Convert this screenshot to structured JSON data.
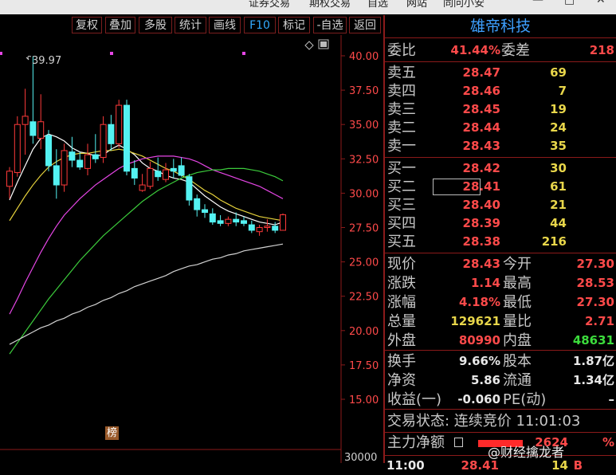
{
  "top_menu": [
    "证券交易",
    "期权交易",
    "自选",
    "网站",
    "同问小安"
  ],
  "toolbar": [
    {
      "label": "复权"
    },
    {
      "label": "叠加"
    },
    {
      "label": "多股"
    },
    {
      "label": "统计"
    },
    {
      "label": "画线"
    },
    {
      "label": "F10",
      "active": true
    },
    {
      "label": "标记"
    },
    {
      "label": "-自选"
    },
    {
      "label": "返回"
    }
  ],
  "chart_data": {
    "type": "candlestick",
    "price_axis": {
      "ticks": [
        "40.00",
        "37.50",
        "35.00",
        "32.50",
        "30.00",
        "27.50",
        "25.00",
        "22.50",
        "20.00",
        "17.50",
        "15.00"
      ],
      "ylim": [
        15.0,
        40.0
      ]
    },
    "volume_axis_label": "30000",
    "max_marker": "39.97",
    "badge": "榜",
    "candles": [
      {
        "o": 30.5,
        "h": 31.9,
        "l": 29.6,
        "c": 31.6
      },
      {
        "o": 31.5,
        "h": 35.6,
        "l": 31.2,
        "c": 35.0
      },
      {
        "o": 35.0,
        "h": 37.6,
        "l": 32.8,
        "c": 35.6
      },
      {
        "o": 35.2,
        "h": 39.97,
        "l": 33.6,
        "c": 34.2
      },
      {
        "o": 34.0,
        "h": 37.2,
        "l": 33.2,
        "c": 35.2
      },
      {
        "o": 34.2,
        "h": 34.6,
        "l": 31.6,
        "c": 32.0
      },
      {
        "o": 32.0,
        "h": 33.2,
        "l": 29.6,
        "c": 30.6
      },
      {
        "o": 30.6,
        "h": 33.6,
        "l": 30.1,
        "c": 33.1
      },
      {
        "o": 33.0,
        "h": 34.1,
        "l": 31.9,
        "c": 32.4
      },
      {
        "o": 32.4,
        "h": 33.0,
        "l": 31.7,
        "c": 31.9
      },
      {
        "o": 31.8,
        "h": 33.6,
        "l": 31.3,
        "c": 32.8
      },
      {
        "o": 32.8,
        "h": 34.3,
        "l": 32.2,
        "c": 32.5
      },
      {
        "o": 32.6,
        "h": 35.6,
        "l": 32.2,
        "c": 35.0
      },
      {
        "o": 35.0,
        "h": 35.7,
        "l": 33.1,
        "c": 33.6
      },
      {
        "o": 33.6,
        "h": 36.8,
        "l": 33.3,
        "c": 36.4
      },
      {
        "o": 36.4,
        "h": 36.8,
        "l": 31.3,
        "c": 31.6
      },
      {
        "o": 31.8,
        "h": 32.4,
        "l": 30.6,
        "c": 31.1
      },
      {
        "o": 30.2,
        "h": 31.4,
        "l": 30.1,
        "c": 30.6
      },
      {
        "o": 30.5,
        "h": 32.3,
        "l": 30.3,
        "c": 31.8
      },
      {
        "o": 31.6,
        "h": 32.6,
        "l": 30.9,
        "c": 31.2
      },
      {
        "o": 31.0,
        "h": 32.2,
        "l": 30.8,
        "c": 31.7
      },
      {
        "o": 31.8,
        "h": 32.5,
        "l": 31.1,
        "c": 31.6
      },
      {
        "o": 32.0,
        "h": 32.6,
        "l": 31.2,
        "c": 31.3
      },
      {
        "o": 31.2,
        "h": 31.4,
        "l": 29.1,
        "c": 29.5
      },
      {
        "o": 29.6,
        "h": 29.9,
        "l": 28.3,
        "c": 28.8
      },
      {
        "o": 28.8,
        "h": 29.2,
        "l": 28.2,
        "c": 28.6
      },
      {
        "o": 28.5,
        "h": 28.9,
        "l": 27.7,
        "c": 27.9
      },
      {
        "o": 28.0,
        "h": 28.4,
        "l": 27.6,
        "c": 27.8
      },
      {
        "o": 27.8,
        "h": 28.3,
        "l": 27.6,
        "c": 28.1
      },
      {
        "o": 28.1,
        "h": 28.6,
        "l": 27.6,
        "c": 27.9
      },
      {
        "o": 28.0,
        "h": 28.3,
        "l": 27.6,
        "c": 27.8
      },
      {
        "o": 27.7,
        "h": 28.0,
        "l": 27.1,
        "c": 27.3
      },
      {
        "o": 27.2,
        "h": 27.7,
        "l": 26.9,
        "c": 27.5
      },
      {
        "o": 27.5,
        "h": 28.1,
        "l": 27.2,
        "c": 27.6
      },
      {
        "o": 27.6,
        "h": 27.9,
        "l": 27.1,
        "c": 27.3
      },
      {
        "o": 27.3,
        "h": 28.53,
        "l": 27.3,
        "c": 28.43
      }
    ],
    "ma_lines": [
      {
        "color": "#ffffff",
        "values": [
          29.5,
          30.8,
          32.0,
          33.2,
          34.0,
          34.3,
          34.1,
          33.8,
          33.3,
          33.0,
          32.9,
          32.7,
          32.8,
          33.2,
          33.5,
          33.2,
          32.8,
          32.2,
          31.8,
          31.6,
          31.3,
          31.1,
          31.0,
          30.8,
          30.3,
          29.8,
          29.4,
          29.0,
          28.7,
          28.5,
          28.3,
          28.1,
          27.9,
          27.8,
          27.7,
          27.9
        ]
      },
      {
        "color": "#e6d23c",
        "values": [
          28.0,
          28.9,
          29.8,
          30.6,
          31.3,
          31.9,
          32.3,
          32.6,
          32.8,
          32.9,
          32.9,
          33.0,
          33.1,
          33.1,
          33.2,
          33.1,
          32.9,
          32.7,
          32.4,
          32.1,
          31.8,
          31.6,
          31.3,
          31.0,
          30.6,
          30.2,
          29.9,
          29.5,
          29.2,
          28.9,
          28.7,
          28.5,
          28.3,
          28.2,
          28.1,
          28.0
        ]
      },
      {
        "color": "#e646e6",
        "values": [
          21.2,
          22.3,
          23.5,
          24.6,
          25.7,
          26.7,
          27.6,
          28.4,
          29.0,
          29.6,
          30.1,
          30.6,
          31.0,
          31.4,
          31.8,
          32.1,
          32.3,
          32.5,
          32.6,
          32.7,
          32.7,
          32.7,
          32.6,
          32.5,
          32.3,
          32.0,
          31.7,
          31.5,
          31.3,
          31.1,
          30.9,
          30.7,
          30.5,
          30.2,
          29.9,
          29.6
        ]
      },
      {
        "color": "#3ccc3c",
        "values": [
          18.3,
          19.1,
          19.9,
          20.7,
          21.5,
          22.3,
          23.0,
          23.7,
          24.4,
          25.1,
          25.7,
          26.3,
          26.9,
          27.4,
          27.9,
          28.4,
          28.9,
          29.4,
          29.8,
          30.2,
          30.5,
          30.8,
          31.1,
          31.3,
          31.5,
          31.6,
          31.7,
          31.7,
          31.8,
          31.8,
          31.8,
          31.7,
          31.6,
          31.4,
          31.2,
          30.9
        ]
      },
      {
        "color": "#d2d2d2",
        "values": [
          19.0,
          19.3,
          19.6,
          19.9,
          20.2,
          20.4,
          20.7,
          20.9,
          21.2,
          21.4,
          21.7,
          21.9,
          22.2,
          22.4,
          22.7,
          22.9,
          23.2,
          23.4,
          23.6,
          23.8,
          24.0,
          24.3,
          24.5,
          24.7,
          24.8,
          25.0,
          25.2,
          25.3,
          25.5,
          25.6,
          25.8,
          25.9,
          26.0,
          26.1,
          26.2,
          26.3
        ]
      }
    ]
  },
  "quote": {
    "stock_name": "雄帝科技",
    "weibi_label": "委比",
    "weibi": "41.44%",
    "weicha_label": "委差",
    "weicha": "218",
    "asks": [
      {
        "label": "卖五",
        "price": "28.47",
        "vol": "69"
      },
      {
        "label": "卖四",
        "price": "28.46",
        "vol": "7"
      },
      {
        "label": "卖三",
        "price": "28.45",
        "vol": "19"
      },
      {
        "label": "卖二",
        "price": "28.44",
        "vol": "24"
      },
      {
        "label": "卖一",
        "price": "28.43",
        "vol": "35"
      }
    ],
    "bids": [
      {
        "label": "买一",
        "price": "28.42",
        "vol": "30"
      },
      {
        "label": "买二",
        "price": "28.41",
        "vol": "61"
      },
      {
        "label": "买三",
        "price": "28.40",
        "vol": "21"
      },
      {
        "label": "买四",
        "price": "28.39",
        "vol": "44"
      },
      {
        "label": "买五",
        "price": "28.38",
        "vol": "216"
      }
    ],
    "stats": [
      {
        "l1": "现价",
        "v1": "28.43",
        "c1": "red",
        "l2": "今开",
        "v2": "27.30",
        "c2": "red"
      },
      {
        "l1": "涨跌",
        "v1": "1.14",
        "c1": "red",
        "l2": "最高",
        "v2": "28.53",
        "c2": "red"
      },
      {
        "l1": "涨幅",
        "v1": "4.18%",
        "c1": "red",
        "l2": "最低",
        "v2": "27.30",
        "c2": "red"
      },
      {
        "l1": "总量",
        "v1": "129621",
        "c1": "yel",
        "l2": "量比",
        "v2": "2.71",
        "c2": "red"
      },
      {
        "l1": "外盘",
        "v1": "80990",
        "c1": "red",
        "l2": "内盘",
        "v2": "48631",
        "c2": "grn"
      }
    ],
    "stats2": [
      {
        "l1": "换手",
        "v1": "9.66%",
        "l2": "股本",
        "v2": "1.87亿"
      },
      {
        "l1": "净资",
        "v1": "5.86",
        "l2": "流通",
        "v2": "1.34亿"
      },
      {
        "l1": "收益(一)",
        "v1": "-0.060",
        "l2": "PE(动)",
        "v2": "–"
      }
    ],
    "trade_status": "交易状态: 连续竞价 11:01:03",
    "main_flow_label": "主力净额",
    "main_flow_value": "2624",
    "main_flow_pct": "%",
    "tick_time": "11:00",
    "tick_price": "28.41",
    "tick_vol": "14",
    "tick_flag": "B"
  },
  "watermark": "@财经擒龙者"
}
